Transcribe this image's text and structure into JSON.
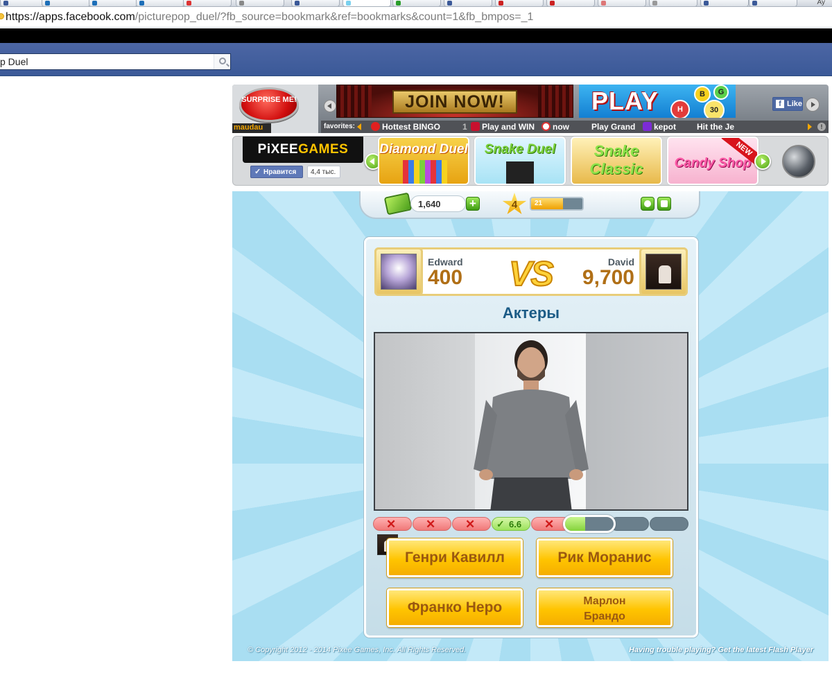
{
  "browser": {
    "url_host": "https://apps.facebook.com",
    "url_rest": "/picturepop_duel/?fb_source=bookmark&ref=bookmarks&count=1&fb_bmpos=_1",
    "user_label": "Ay"
  },
  "facebook": {
    "search_value": "p Duel"
  },
  "ads": {
    "surprise_label": "SURPRISE ME!",
    "brand": "maudau",
    "join_label": "JOIN NOW!",
    "play_label": "PLAY",
    "play_balls": [
      "H",
      "B",
      "30",
      "G"
    ],
    "like_label": "Like",
    "favorites_label": "favorites:",
    "favorites": [
      "Hottest BINGO",
      "Play and WIN",
      "now",
      "Play Grand",
      "kepot",
      "Hit the Je"
    ],
    "info_glyph": "!"
  },
  "games_bar": {
    "logo_left": "PiXEE",
    "logo_right": "GAMES",
    "like_label": "Нравится",
    "like_count": "4,4 тыс.",
    "games": [
      {
        "name": "Diamond Duel",
        "color": "#f7a21b"
      },
      {
        "name": "Snake Duel",
        "color": "#8bd43a"
      },
      {
        "name": "Snake Classic",
        "color": "#6ac41f"
      },
      {
        "name": "Candy Shop",
        "color": "#e94b8f"
      }
    ],
    "new_badge": "NEW"
  },
  "status": {
    "coins": "1,640",
    "plus_label": "+",
    "level": "4",
    "xp": "21",
    "xp_fraction": 0.62
  },
  "duel": {
    "player1": {
      "name": "Edward",
      "score": "400"
    },
    "vs_label": "VS",
    "player2": {
      "name": "David",
      "score": "9,700"
    },
    "category": "Актеры",
    "progress": [
      {
        "state": "wrong"
      },
      {
        "state": "wrong"
      },
      {
        "state": "wrong"
      },
      {
        "state": "right",
        "value": "6.6"
      },
      {
        "state": "wrong"
      },
      {
        "state": "current",
        "fraction": 0.42
      },
      {
        "state": "pending"
      },
      {
        "state": "pending"
      }
    ],
    "wrong_glyph": "✕",
    "right_glyph": "✓",
    "answers": [
      {
        "label": "Генри Кавилл"
      },
      {
        "label": "Рик Моранис"
      },
      {
        "label": "Франко Неро"
      },
      {
        "label_line1": "Марлон",
        "label_line2": "Брандо"
      }
    ]
  },
  "footer": {
    "copyright": "© Copyright 2012 - 2014 Pixee Games, Inc.  All Rights Reserved.",
    "flash_help": "Having trouble playing? Get the latest Flash Player"
  },
  "colors": {
    "fb_blue": "#3b5998",
    "stage_blue": "#a9def2",
    "answer_gold": "#ffc400",
    "score_brown": "#b06f16",
    "category_blue": "#1b5b86"
  }
}
